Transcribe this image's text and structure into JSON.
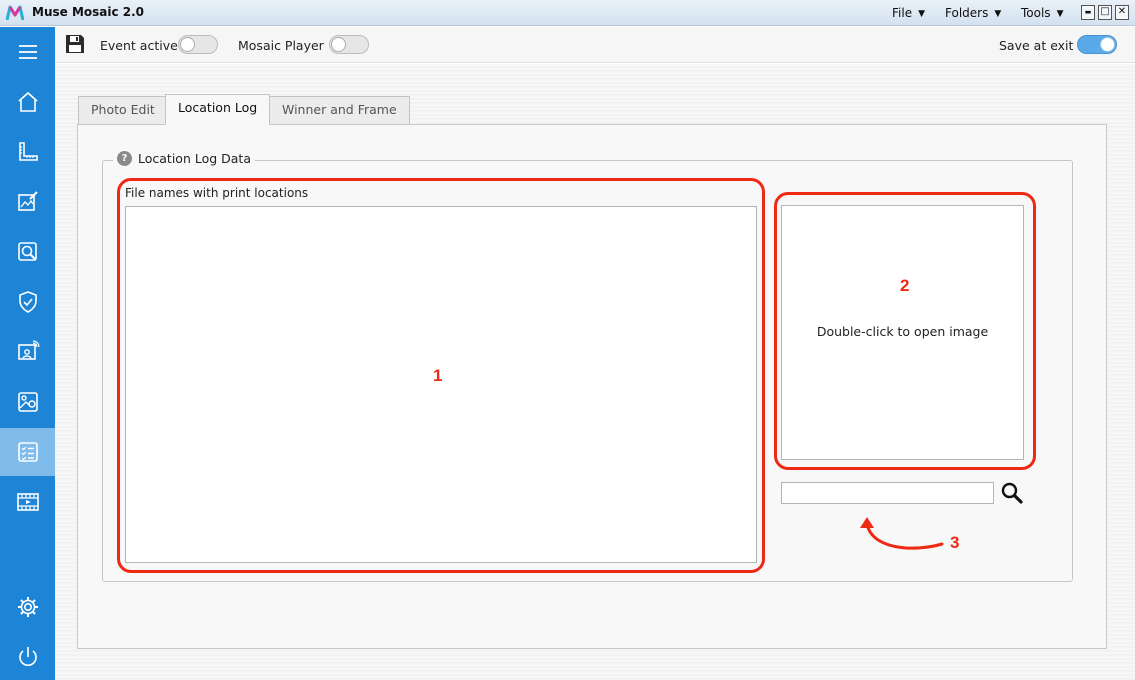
{
  "app": {
    "title": "Muse Mosaic 2.0",
    "menus": [
      {
        "label": "File"
      },
      {
        "label": "Folders"
      },
      {
        "label": "Tools"
      }
    ],
    "window_controls": {
      "minimize": "▬",
      "maximize": "□",
      "close": "✕"
    }
  },
  "sidebar": {
    "items": [
      {
        "icon": "hamburger-menu-icon",
        "active": false
      },
      {
        "icon": "home-icon",
        "active": false
      },
      {
        "icon": "ruler-icon",
        "active": false
      },
      {
        "icon": "photo-edit-icon",
        "active": false
      },
      {
        "icon": "zoom-photo-icon",
        "active": false
      },
      {
        "icon": "shield-check-icon",
        "active": false
      },
      {
        "icon": "presentation-user-icon",
        "active": false
      },
      {
        "icon": "image-location-icon",
        "active": false
      },
      {
        "icon": "checklist-icon",
        "active": true
      },
      {
        "icon": "video-film-icon",
        "active": false
      },
      {
        "icon": "gear-icon",
        "active": false
      },
      {
        "icon": "power-icon",
        "active": false
      }
    ]
  },
  "toolbar": {
    "save_icon": "floppy-disk-icon",
    "event_active_label": "Event active",
    "event_active_on": false,
    "mosaic_player_label": "Mosaic Player",
    "mosaic_player_on": false,
    "save_at_exit_label": "Save at exit",
    "save_at_exit_on": true
  },
  "tabs": [
    {
      "label": "Photo Edit",
      "active": false
    },
    {
      "label": "Location Log",
      "active": true
    },
    {
      "label": "Winner and Frame",
      "active": false
    }
  ],
  "location_log": {
    "group_title": "Location Log Data",
    "list_label": "File names with print locations",
    "file_names": [],
    "preview_hint": "Double-click to open image",
    "search_value": ""
  },
  "annotations": {
    "file_list_number": "1",
    "preview_number": "2",
    "search_number": "3",
    "color": "#ee2a14"
  },
  "colors": {
    "sidebar": "#1e85d6",
    "sidebar_active": "#7fbbeb",
    "toggle_on": "#5aa9e8"
  }
}
